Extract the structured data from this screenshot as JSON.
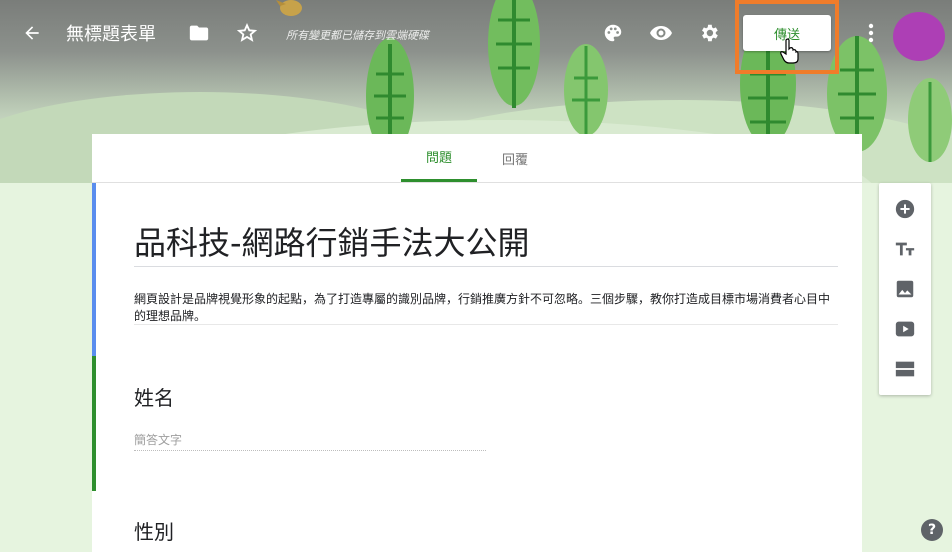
{
  "header": {
    "title": "無標題表單",
    "save_status": "所有變更都已儲存到雲端硬碟",
    "send_label": "傳送"
  },
  "tabs": [
    {
      "label": "問題",
      "active": true
    },
    {
      "label": "回覆",
      "active": false
    }
  ],
  "form": {
    "title": "品科技-網路行銷手法大公開",
    "description": "網頁設計是品牌視覺形象的起點，為了打造專屬的識別品牌，行銷推廣方針不可忽略。三個步驟，教你打造成目標市場消費者心目中的理想品牌。",
    "questions": [
      {
        "title": "姓名",
        "answer_placeholder": "簡答文字"
      },
      {
        "title": "性別"
      }
    ]
  },
  "side_toolbar": {
    "icons": [
      "add-question-icon",
      "title-text-icon",
      "image-icon",
      "video-icon",
      "section-icon"
    ]
  },
  "colors": {
    "accent_green": "#2e8f2e",
    "accent_blue": "#5a8dee",
    "highlight_orange": "#f07c2a",
    "avatar": "#ad3fb5"
  }
}
